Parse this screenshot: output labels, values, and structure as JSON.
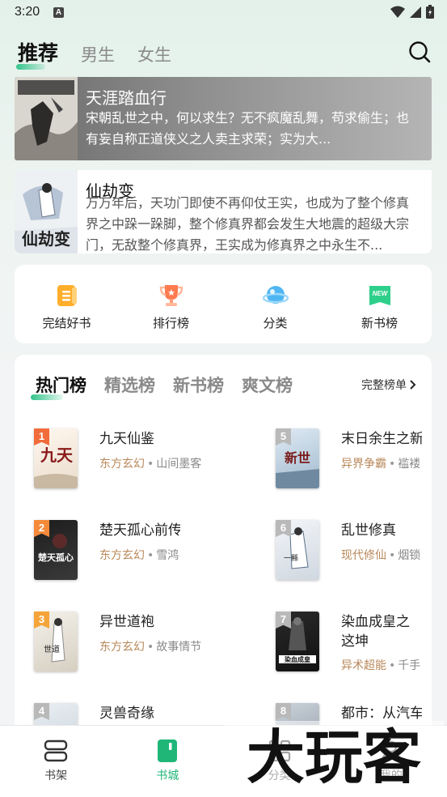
{
  "status": {
    "time": "3:20",
    "notif_letter": "A"
  },
  "top_tabs": [
    {
      "label": "推荐",
      "active": true
    },
    {
      "label": "男生",
      "active": false
    },
    {
      "label": "女生",
      "active": false
    }
  ],
  "featured": [
    {
      "title": "天涯踏血行",
      "desc": "宋朝乱世之中，何以求生？无不疯魔乱舞，苟求偷生；也有妄自称正道侠义之人卖主求荣；实为大..."
    },
    {
      "title": "仙劫变",
      "desc": "万万年后，天功门即使不再仰仗王实，也成为了整个修真界之中跺一跺脚，整个修真界都会发生大地震的超级大宗门，无敌整个修真界，王实成为修真界之中永生不..."
    }
  ],
  "quick_entries": [
    {
      "label": "完结好书",
      "icon": "finished-book-icon"
    },
    {
      "label": "排行榜",
      "icon": "trophy-icon"
    },
    {
      "label": "分类",
      "icon": "category-planet-icon"
    },
    {
      "label": "新书榜",
      "icon": "new-book-icon"
    }
  ],
  "rank_tabs": [
    {
      "label": "热门榜",
      "active": true
    },
    {
      "label": "精选榜",
      "active": false
    },
    {
      "label": "新书榜",
      "active": false
    },
    {
      "label": "爽文榜",
      "active": false
    }
  ],
  "rank_more": "完整榜单",
  "rank_items": [
    {
      "rank": "1",
      "title": "九天仙鉴",
      "genre": "东方玄幻",
      "author": "山间墨客"
    },
    {
      "rank": "2",
      "title": "楚天孤心前传",
      "genre": "东方玄幻",
      "author": "雪鸿"
    },
    {
      "rank": "3",
      "title": "异世道袍",
      "genre": "东方玄幻",
      "author": "故事情节"
    },
    {
      "rank": "4",
      "title": "灵兽奇缘",
      "genre": "",
      "author": ""
    },
    {
      "rank": "5",
      "title": "末日余生之新",
      "genre": "异界争霸",
      "author": "褴褛"
    },
    {
      "rank": "6",
      "title": "乱世修真",
      "genre": "现代修仙",
      "author": "烟锁"
    },
    {
      "rank": "7",
      "title": "染血成皇之这坤",
      "genre": "异术超能",
      "author": "千手"
    },
    {
      "rank": "8",
      "title": "都市：从汽车",
      "genre": "",
      "author": ""
    }
  ],
  "bottom_nav": [
    {
      "label": "书架",
      "icon": "bookshelf-icon",
      "active": false
    },
    {
      "label": "书城",
      "icon": "bookstore-icon",
      "active": true
    },
    {
      "label": "分类",
      "icon": "category-icon",
      "active": false
    },
    {
      "label": "我的",
      "icon": "profile-icon",
      "active": false
    }
  ],
  "watermark_text": "大玩客",
  "colors": {
    "accent": "#1fb678",
    "genre": "#b8885a",
    "badge_top": "#f26b3a",
    "badge_rest": "#b9b9b9"
  }
}
